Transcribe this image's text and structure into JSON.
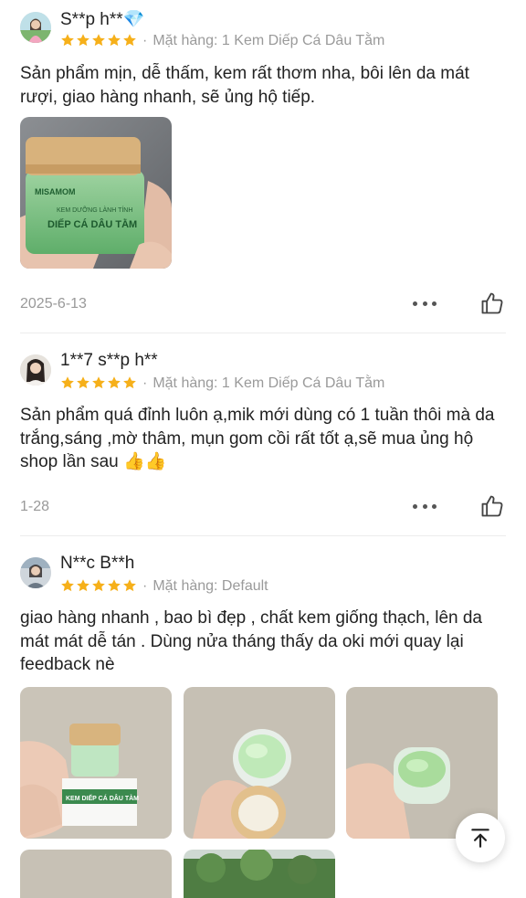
{
  "reviews": [
    {
      "username": "S**p h**💎",
      "rating": 5,
      "variant_label": "Mặt hàng: 1 Kem Diếp Cá Dâu Tằm",
      "text": "Sản phẩm mịn, dễ thấm, kem rất thơm nha, bôi lên da mát rượi, giao hàng nhanh, sẽ ủng hộ tiếp.",
      "date": "2025-6-13",
      "photo_jar_brand": "MISAMOM",
      "photo_jar_subtitle": "KEM DƯỠNG LÀNH TÍNH",
      "photo_jar_product": "DIẾP CÁ DÂU TẰM"
    },
    {
      "username": "1**7 s**p h**",
      "rating": 5,
      "variant_label": "Mặt hàng: 1 Kem Diếp Cá Dâu Tằm",
      "text": "Sản phẩm quá đỉnh luôn ạ,mik mới dùng có 1 tuần thôi mà da trắng,sáng ,mờ thâm, mụn gom cồi rất tốt ạ,sẽ mua ủng hộ shop lần sau 👍👍",
      "date": "1-28"
    },
    {
      "username": "N**c B**h",
      "rating": 5,
      "variant_label": "Mặt hàng: Default",
      "text": "giao hàng nhanh , bao bì đẹp , chất kem giống thạch, lên da mát mát dễ tán . Dùng nửa tháng thấy da oki mới quay lại feedback nè",
      "photo_box_label": "KEM DIẾP CÁ DÂU TẰM"
    }
  ],
  "icons": {
    "more": "more-options-icon",
    "like": "thumbs-up-icon",
    "scroll_top": "arrow-up-to-top-icon",
    "star_color": "#f6b01a"
  }
}
